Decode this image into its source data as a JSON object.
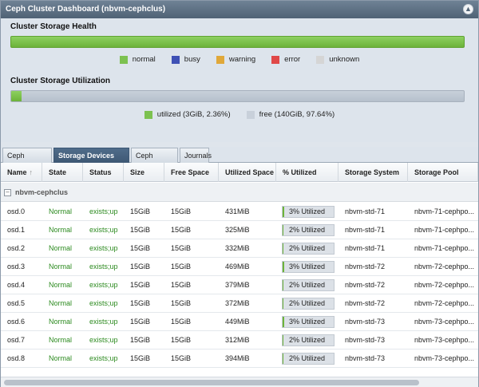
{
  "window": {
    "title": "Ceph Cluster Dashboard (nbvm-cephclus)"
  },
  "health": {
    "title": "Cluster Storage Health",
    "legend": [
      {
        "label": "normal",
        "color": "#7cc150"
      },
      {
        "label": "busy",
        "color": "#3f51b5"
      },
      {
        "label": "warning",
        "color": "#e0a83a"
      },
      {
        "label": "error",
        "color": "#e04848"
      },
      {
        "label": "unknown",
        "color": "#d5d5d5"
      }
    ]
  },
  "utilization": {
    "title": "Cluster Storage Utilization",
    "utilized_fraction": 0.0236,
    "legend": [
      {
        "label": "utilized (3GiB, 2.36%)",
        "color": "#7cc150"
      },
      {
        "label": "free (140GiB, 97.64%)",
        "color": "#c8d0da"
      }
    ]
  },
  "tabs": [
    {
      "label": "Ceph Members",
      "active": false
    },
    {
      "label": "Storage Devices (OSDs)",
      "active": true
    },
    {
      "label": "Ceph Monitors",
      "active": false
    },
    {
      "label": "Journals",
      "active": false
    }
  ],
  "table": {
    "columns": [
      "Name",
      "State",
      "Status",
      "Size",
      "Free Space",
      "Utilized Space",
      "% Utilized",
      "Storage System",
      "Storage Pool"
    ],
    "group_label": "nbvm-cephclus",
    "rows": [
      {
        "name": "osd.0",
        "state": "Normal",
        "status": "exists;up",
        "size": "15GiB",
        "free": "15GiB",
        "utilized": "431MiB",
        "pct": "3% Utilized",
        "pct_value": 3,
        "system": "nbvm-std-71",
        "pool": "nbvm-71-cephpo..."
      },
      {
        "name": "osd.1",
        "state": "Normal",
        "status": "exists;up",
        "size": "15GiB",
        "free": "15GiB",
        "utilized": "325MiB",
        "pct": "2% Utilized",
        "pct_value": 2,
        "system": "nbvm-std-71",
        "pool": "nbvm-71-cephpo..."
      },
      {
        "name": "osd.2",
        "state": "Normal",
        "status": "exists;up",
        "size": "15GiB",
        "free": "15GiB",
        "utilized": "332MiB",
        "pct": "2% Utilized",
        "pct_value": 2,
        "system": "nbvm-std-71",
        "pool": "nbvm-71-cephpo..."
      },
      {
        "name": "osd.3",
        "state": "Normal",
        "status": "exists;up",
        "size": "15GiB",
        "free": "15GiB",
        "utilized": "469MiB",
        "pct": "3% Utilized",
        "pct_value": 3,
        "system": "nbvm-std-72",
        "pool": "nbvm-72-cephpo..."
      },
      {
        "name": "osd.4",
        "state": "Normal",
        "status": "exists;up",
        "size": "15GiB",
        "free": "15GiB",
        "utilized": "379MiB",
        "pct": "2% Utilized",
        "pct_value": 2,
        "system": "nbvm-std-72",
        "pool": "nbvm-72-cephpo..."
      },
      {
        "name": "osd.5",
        "state": "Normal",
        "status": "exists;up",
        "size": "15GiB",
        "free": "15GiB",
        "utilized": "372MiB",
        "pct": "2% Utilized",
        "pct_value": 2,
        "system": "nbvm-std-72",
        "pool": "nbvm-72-cephpo..."
      },
      {
        "name": "osd.6",
        "state": "Normal",
        "status": "exists;up",
        "size": "15GiB",
        "free": "15GiB",
        "utilized": "449MiB",
        "pct": "3% Utilized",
        "pct_value": 3,
        "system": "nbvm-std-73",
        "pool": "nbvm-73-cephpo..."
      },
      {
        "name": "osd.7",
        "state": "Normal",
        "status": "exists;up",
        "size": "15GiB",
        "free": "15GiB",
        "utilized": "312MiB",
        "pct": "2% Utilized",
        "pct_value": 2,
        "system": "nbvm-std-73",
        "pool": "nbvm-73-cephpo..."
      },
      {
        "name": "osd.8",
        "state": "Normal",
        "status": "exists;up",
        "size": "15GiB",
        "free": "15GiB",
        "utilized": "394MiB",
        "pct": "2% Utilized",
        "pct_value": 2,
        "system": "nbvm-std-73",
        "pool": "nbvm-73-cephpo..."
      }
    ]
  }
}
